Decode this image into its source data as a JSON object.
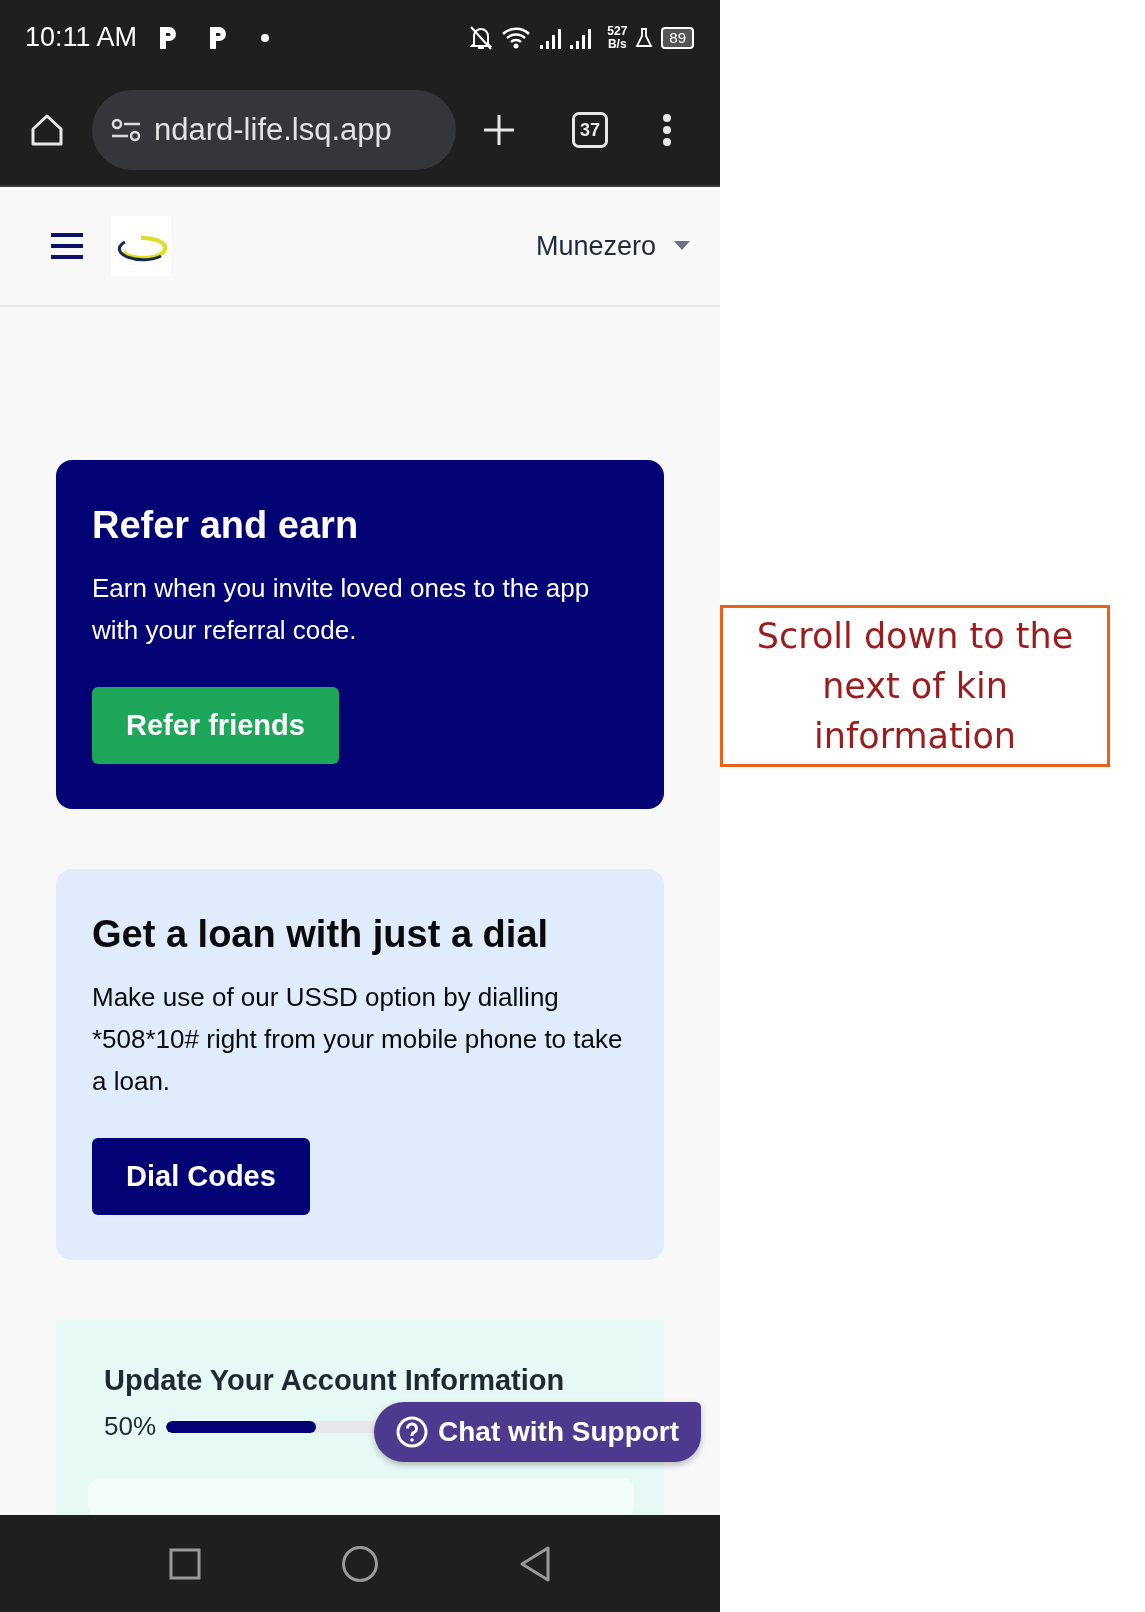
{
  "status_bar": {
    "time": "10:11 AM",
    "speed_value": "527",
    "speed_unit": "B/s",
    "battery": "89"
  },
  "browser": {
    "url": "ndard-life.lsq.app",
    "tab_count": "37"
  },
  "header": {
    "user": "Munezero"
  },
  "refer_card": {
    "title": "Refer and earn",
    "text": "Earn when you invite loved ones to the app with your referral code.",
    "button": "Refer friends"
  },
  "loan_card": {
    "title": "Get a loan with just a dial",
    "text": "Make use of our USSD option by dialling *508*10# right from your mobile phone to take a loan.",
    "button": "Dial Codes"
  },
  "account_card": {
    "title": "Update Your Account Information",
    "percent": "50%",
    "level": 0.5
  },
  "chat_button": {
    "label": "Chat with Support"
  },
  "annotation": {
    "text": "Scroll down to the next of kin information"
  }
}
